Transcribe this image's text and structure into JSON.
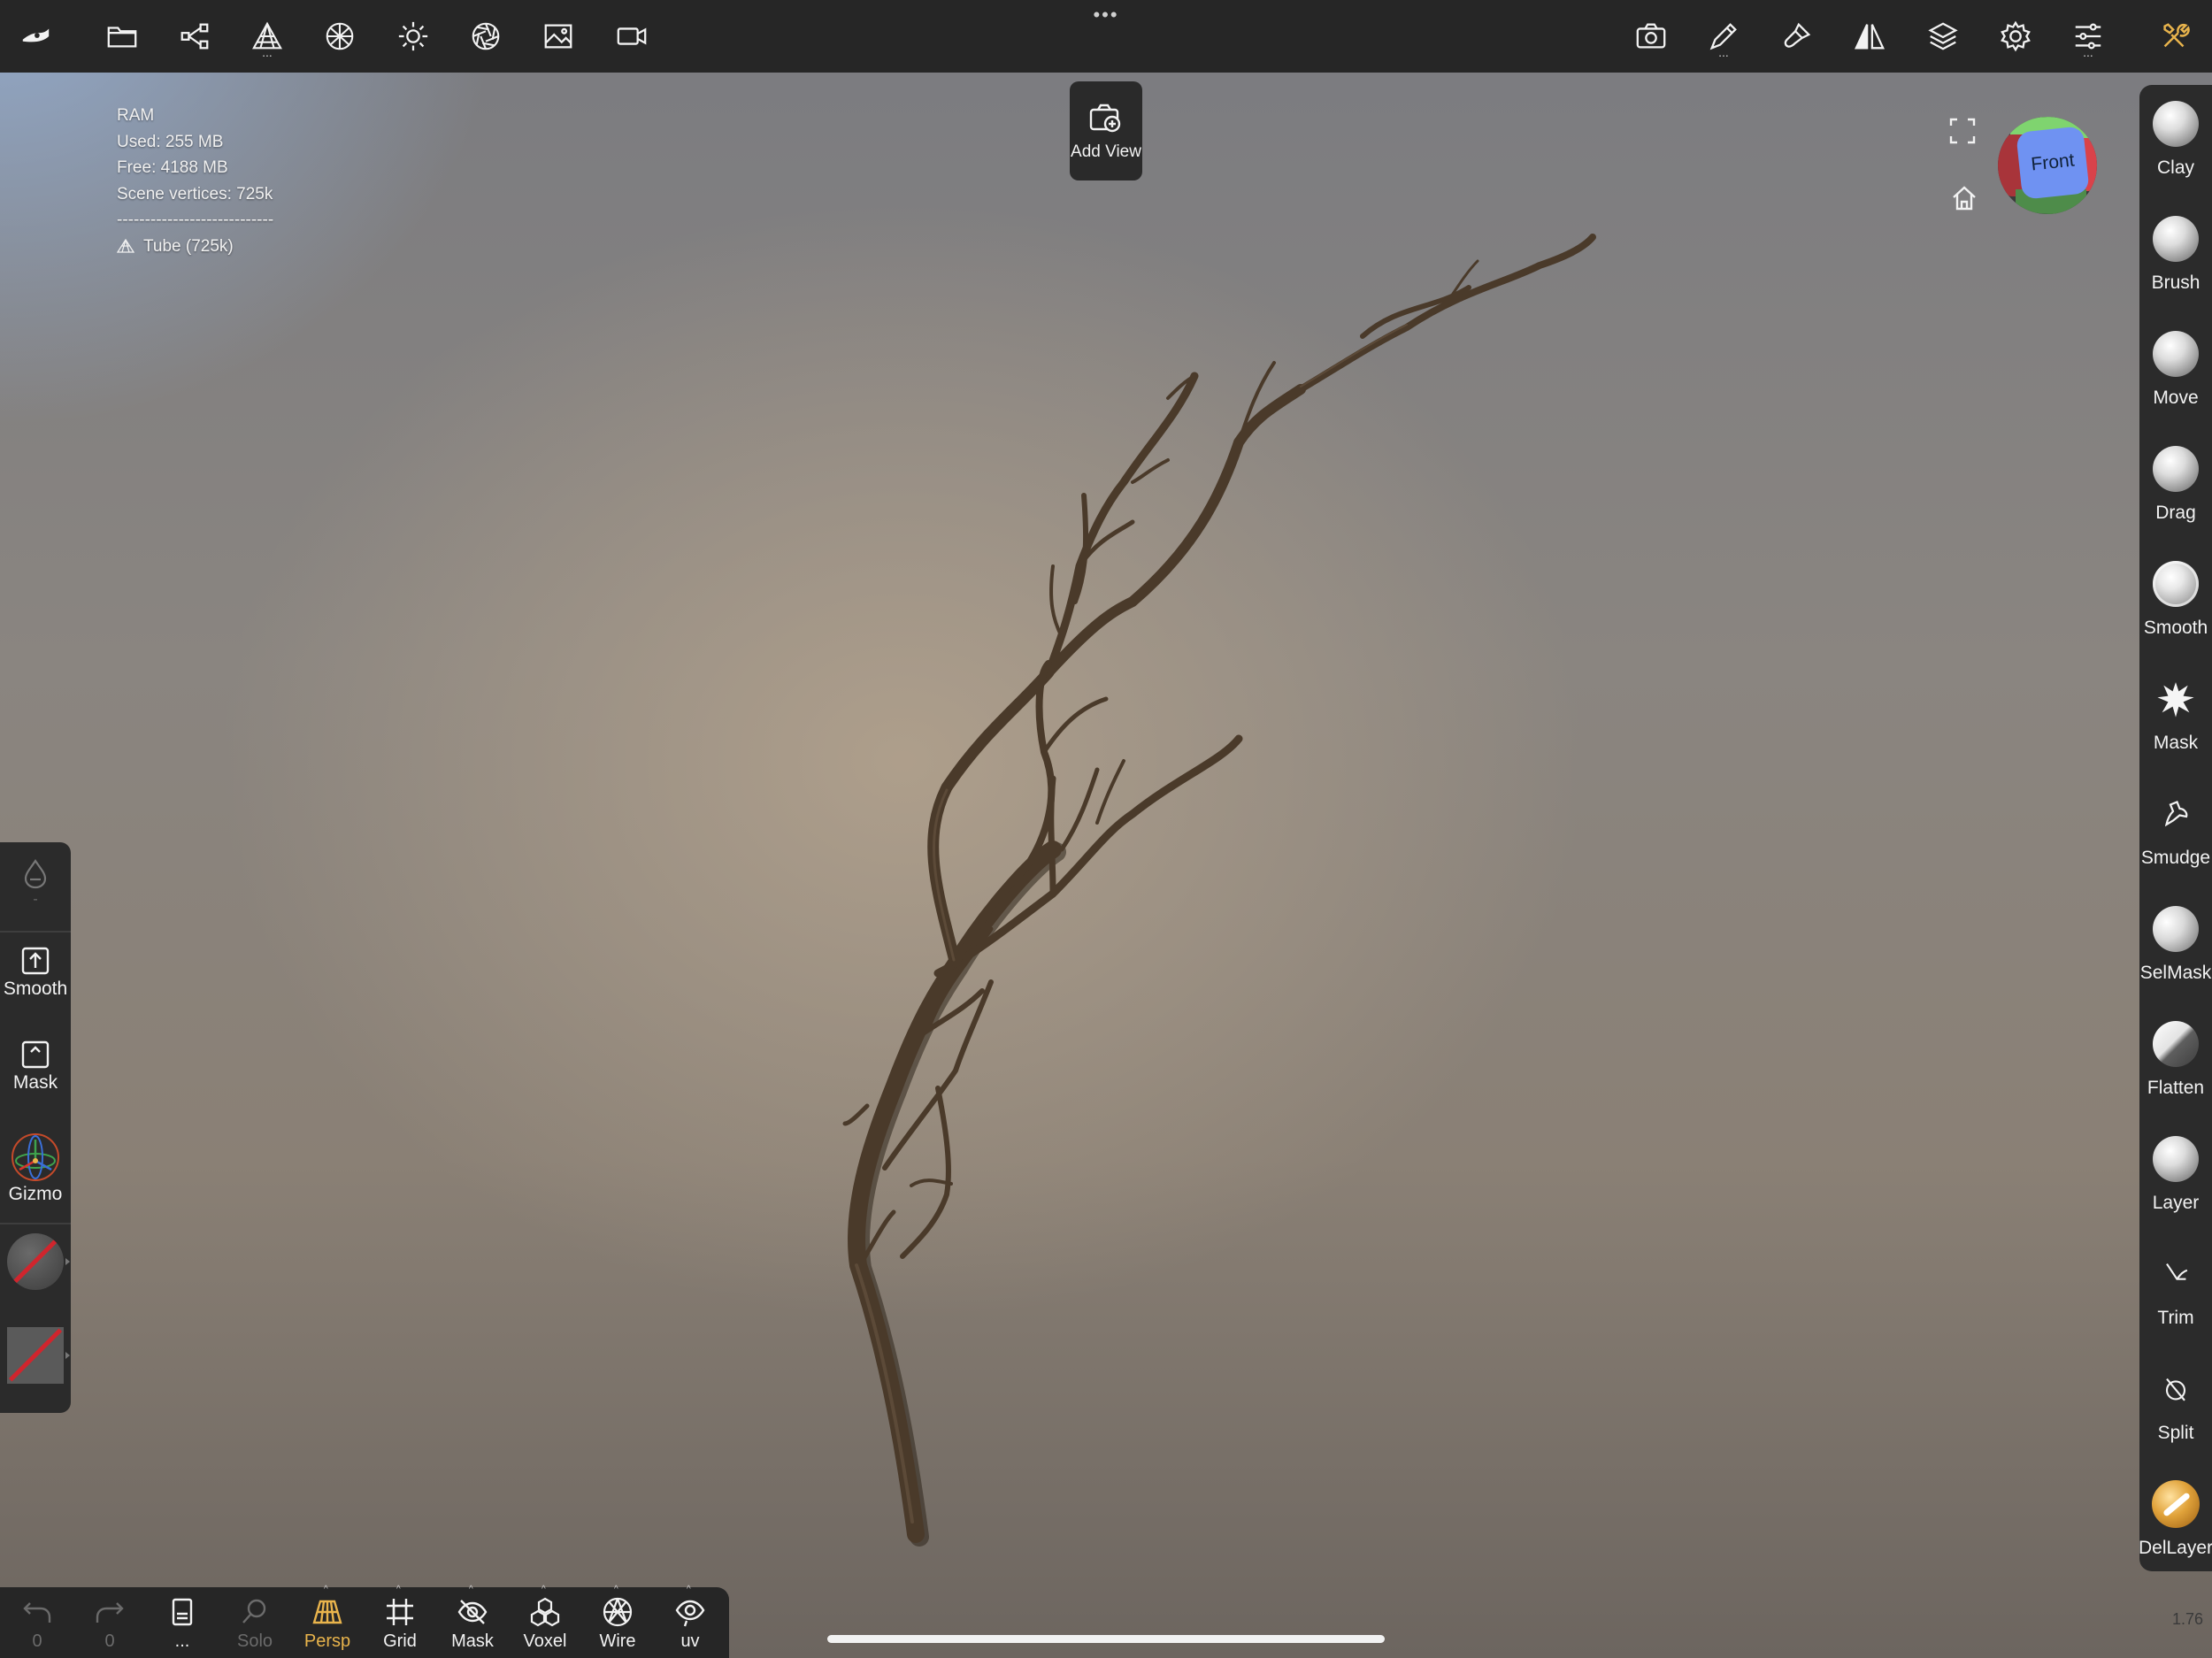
{
  "top_toolbar": {
    "left_icons": [
      "nomad-logo-icon",
      "folder-icon",
      "scene-graph-icon",
      "mesh-icon",
      "material-sphere-icon",
      "light-icon",
      "camera-aperture-icon",
      "image-icon",
      "video-camera-icon"
    ],
    "right_icons": [
      "camera-icon",
      "stroke-icon",
      "paint-icon",
      "symmetry-icon",
      "layers-icon",
      "settings-icon",
      "sliders-icon",
      "tools-icon"
    ],
    "more_dots": "..."
  },
  "stats": {
    "ram_label": "RAM",
    "used": "Used: 255 MB",
    "free": "Free: 4188 MB",
    "scene_vertices": "Scene vertices: 725k",
    "separator": "----------------------------",
    "mesh_name": "Tube (725k)"
  },
  "add_view": {
    "label": "Add View"
  },
  "view_cube": {
    "face_label": "Front"
  },
  "right_tools": [
    {
      "label": "Clay"
    },
    {
      "label": "Brush"
    },
    {
      "label": "Move"
    },
    {
      "label": "Drag"
    },
    {
      "label": "Smooth"
    },
    {
      "label": "Mask"
    },
    {
      "label": "Smudge"
    },
    {
      "label": "SelMask"
    },
    {
      "label": "Flatten"
    },
    {
      "label": "Layer"
    },
    {
      "label": "Trim"
    },
    {
      "label": "Split"
    },
    {
      "label": "DelLayer"
    }
  ],
  "zoom_readout": "1.76",
  "left_panel": {
    "dash": "-",
    "smooth_label": "Smooth",
    "mask_label": "Mask",
    "gizmo_label": "Gizmo"
  },
  "bottom_bar": {
    "undo_count": "0",
    "redo_count": "0",
    "more_label": "...",
    "solo_label": "Solo",
    "persp_label": "Persp",
    "grid_label": "Grid",
    "mask_label": "Mask",
    "voxel_label": "Voxel",
    "wire_label": "Wire",
    "uv_label": "uv"
  },
  "colors": {
    "accent": "#e9b44c",
    "toolbar_bg": "#262626",
    "panel_bg": "#2b2b2b",
    "disabled": "#6b6b6b",
    "front_face": "#6f92f2"
  }
}
